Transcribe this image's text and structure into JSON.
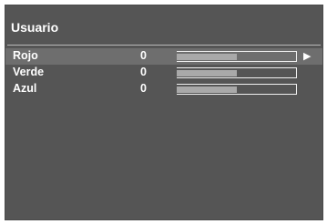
{
  "menu": {
    "title": "Usuario",
    "selected_index": 0,
    "items": [
      {
        "label": "Rojo",
        "value": "0",
        "level": 0.5
      },
      {
        "label": "Verde",
        "value": "0",
        "level": 0.5
      },
      {
        "label": "Azul",
        "value": "0",
        "level": 0.5
      }
    ],
    "arrow_glyph": "▶"
  }
}
